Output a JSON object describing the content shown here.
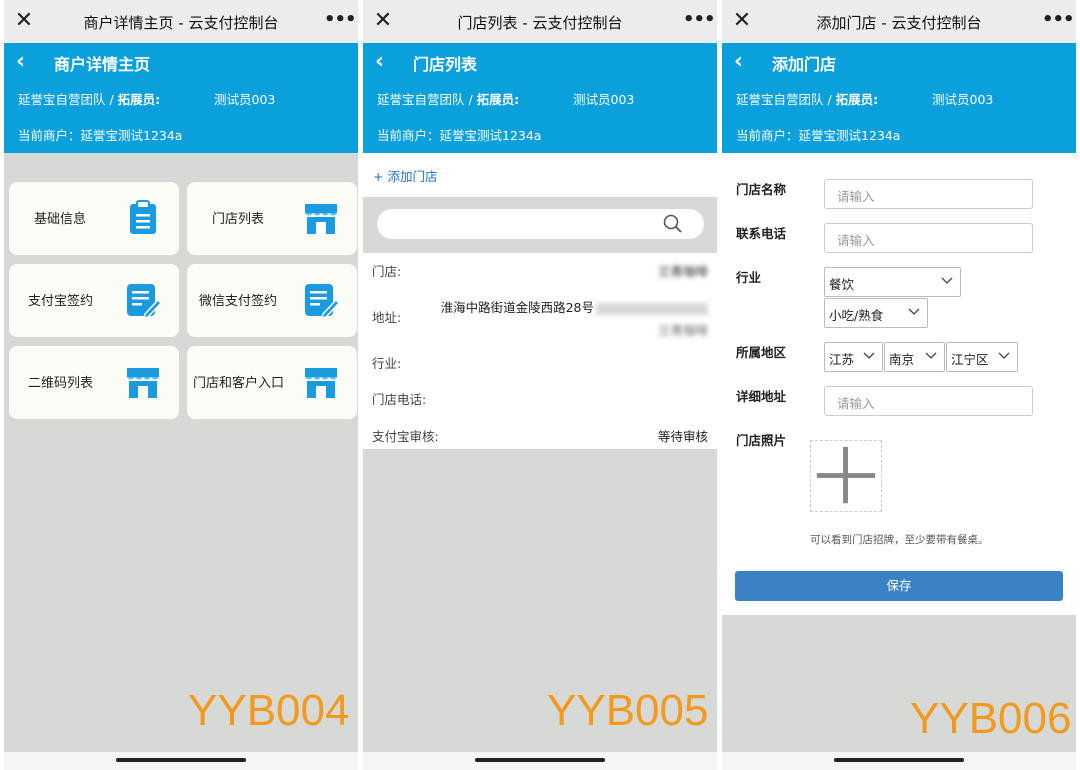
{
  "screens": [
    {
      "title": "商户详情主页 - 云支付控制台",
      "header": "商户详情主页",
      "team": "延誉宝自营团队 /",
      "role_label": "拓展员:",
      "operator": "测试员003",
      "merchant": "当前商户：延誉宝测试1234a",
      "cards": [
        {
          "label": "基础信息",
          "icon": "clipboard-icon"
        },
        {
          "label": "门店列表",
          "icon": "store-icon"
        },
        {
          "label": "支付宝签约",
          "icon": "sign-document-icon"
        },
        {
          "label": "微信支付签约",
          "icon": "sign-document-icon"
        },
        {
          "label": "二维码列表",
          "icon": "store-icon"
        },
        {
          "label": "门店和客户入口",
          "icon": "store-icon"
        }
      ],
      "watermark": "YYB004"
    },
    {
      "title": "门店列表 - 云支付控制台",
      "header": "门店列表",
      "team": "延誉宝自营团队 /",
      "role_label": "拓展员:",
      "operator": "测试员003",
      "merchant": "当前商户：延誉宝测试1234a",
      "add_link": "+ 添加门店",
      "store": {
        "name_label": "门店:",
        "name_value": "兰青咖啡",
        "address_label": "地址:",
        "address_line1": "淮海中路街道金陵西路28号",
        "address_line2": "兰青咖啡",
        "industry_label": "行业:",
        "phone_label": "门店电话:",
        "alipay_label": "支付宝审核:",
        "alipay_value": "等待审核"
      },
      "watermark": "YYB005"
    },
    {
      "title": "添加门店 - 云支付控制台",
      "header": "添加门店",
      "team": "延誉宝自营团队 /",
      "role_label": "拓展员:",
      "operator": "测试员003",
      "merchant": "当前商户：延誉宝测试1234a",
      "form": {
        "name_label": "门店名称",
        "phone_label": "联系电话",
        "industry_label": "行业",
        "industry_main": "餐饮",
        "industry_sub": "小吃/熟食",
        "region_label": "所属地区",
        "province": "江苏",
        "city": "南京",
        "district": "江宁区",
        "address_label": "详细地址",
        "photo_label": "门店照片",
        "placeholder": "请输入",
        "hint": "可以看到门店招牌，至少要带有餐桌。",
        "save": "保存"
      },
      "watermark": "YYB006"
    }
  ],
  "colors": {
    "header_bg": "#0aa0dc",
    "icon_blue": "#1a9be0",
    "save_btn": "#3b82c4",
    "watermark": "#f39a1e"
  }
}
